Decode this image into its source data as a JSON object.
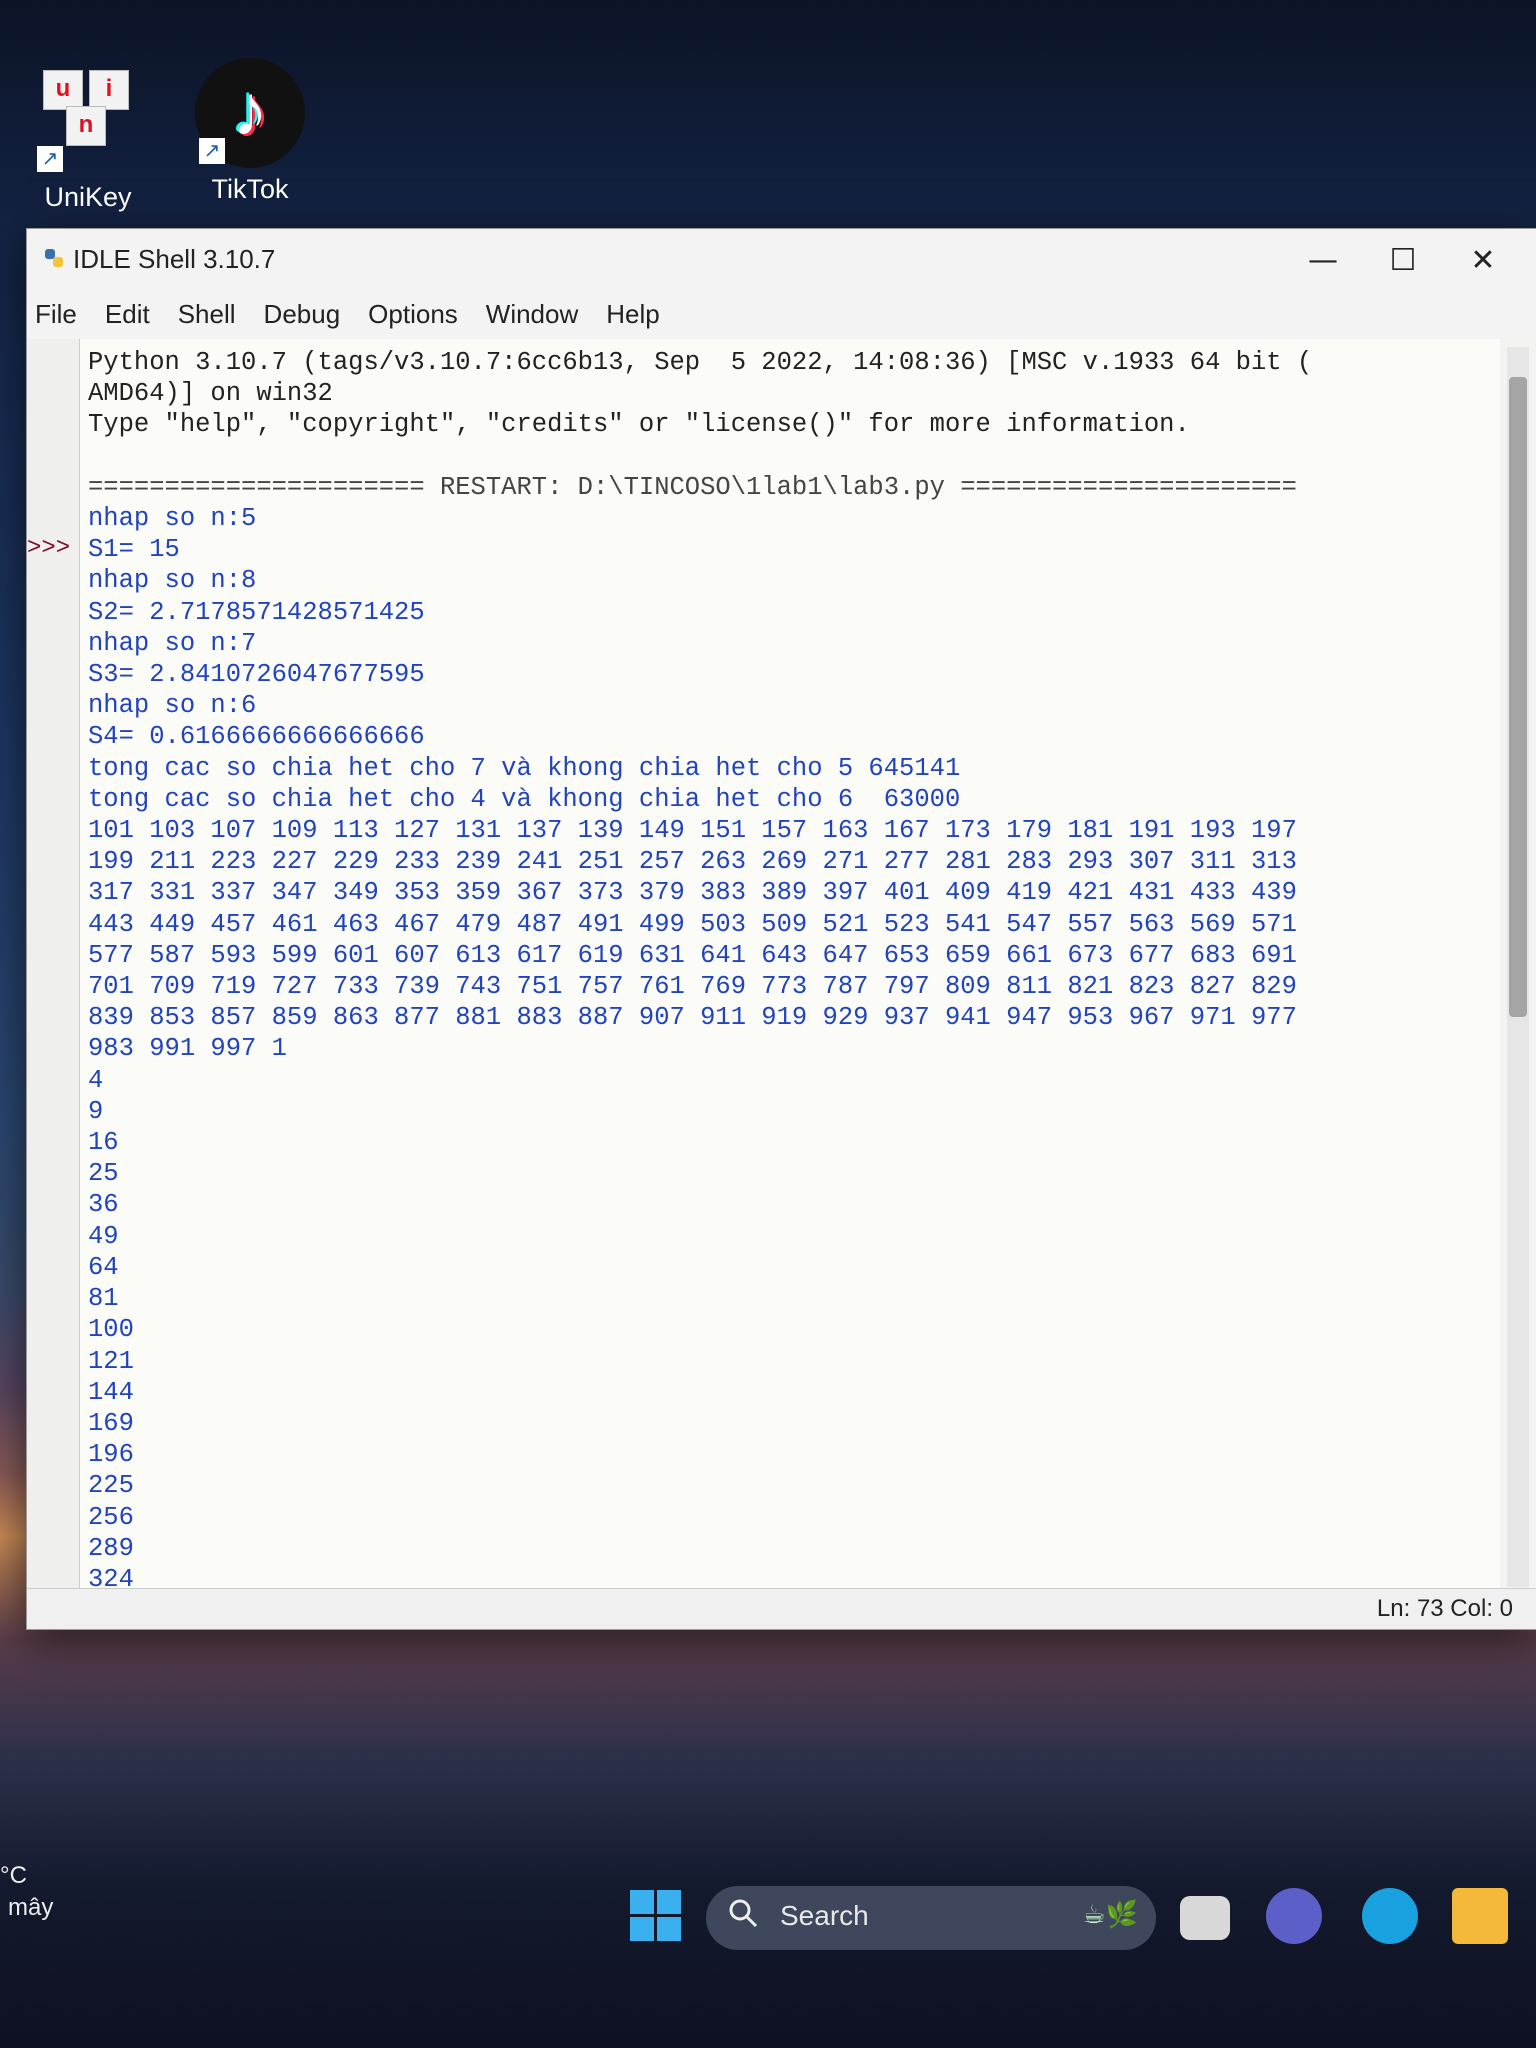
{
  "desktop": {
    "icons": [
      {
        "label": "UniKey",
        "letters": [
          "u",
          "i",
          "n"
        ]
      },
      {
        "label": "TikTok"
      }
    ]
  },
  "window": {
    "title": "IDLE Shell 3.10.7",
    "controls": {
      "minimize": "—",
      "maximize": "☐",
      "close": "✕"
    },
    "menu": [
      "File",
      "Edit",
      "Shell",
      "Debug",
      "Options",
      "Window",
      "Help"
    ],
    "prompt": ">>>",
    "shell_lines": [
      {
        "kind": "sys",
        "text": "Python 3.10.7 (tags/v3.10.7:6cc6b13, Sep  5 2022, 14:08:36) [MSC v.1933 64 bit ("
      },
      {
        "kind": "sys",
        "text": "AMD64)] on win32"
      },
      {
        "kind": "sys",
        "text": "Type \"help\", \"copyright\", \"credits\" or \"license()\" for more information."
      },
      {
        "kind": "sys",
        "text": ""
      },
      {
        "kind": "restart",
        "text": "====================== RESTART: D:\\TINCOSO\\1lab1\\lab3.py ======================"
      },
      {
        "kind": "out",
        "text": "nhap so n:5"
      },
      {
        "kind": "out",
        "text": "S1= 15"
      },
      {
        "kind": "out",
        "text": "nhap so n:8"
      },
      {
        "kind": "out",
        "text": "S2= 2.7178571428571425"
      },
      {
        "kind": "out",
        "text": "nhap so n:7"
      },
      {
        "kind": "out",
        "text": "S3= 2.8410726047677595"
      },
      {
        "kind": "out",
        "text": "nhap so n:6"
      },
      {
        "kind": "out",
        "text": "S4= 0.6166666666666666"
      },
      {
        "kind": "out",
        "text": "tong cac so chia het cho 7 và khong chia het cho 5 645141"
      },
      {
        "kind": "out",
        "text": "tong cac so chia het cho 4 và khong chia het cho 6  63000"
      },
      {
        "kind": "out",
        "text": "101 103 107 109 113 127 131 137 139 149 151 157 163 167 173 179 181 191 193 197"
      },
      {
        "kind": "out",
        "text": "199 211 223 227 229 233 239 241 251 257 263 269 271 277 281 283 293 307 311 313"
      },
      {
        "kind": "out",
        "text": "317 331 337 347 349 353 359 367 373 379 383 389 397 401 409 419 421 431 433 439"
      },
      {
        "kind": "out",
        "text": "443 449 457 461 463 467 479 487 491 499 503 509 521 523 541 547 557 563 569 571"
      },
      {
        "kind": "out",
        "text": "577 587 593 599 601 607 613 617 619 631 641 643 647 653 659 661 673 677 683 691"
      },
      {
        "kind": "out",
        "text": "701 709 719 727 733 739 743 751 757 761 769 773 787 797 809 811 821 823 827 829"
      },
      {
        "kind": "out",
        "text": "839 853 857 859 863 877 881 883 887 907 911 919 929 937 941 947 953 967 971 977"
      },
      {
        "kind": "out",
        "text": "983 991 997 1"
      },
      {
        "kind": "out",
        "text": "4"
      },
      {
        "kind": "out",
        "text": "9"
      },
      {
        "kind": "out",
        "text": "16"
      },
      {
        "kind": "out",
        "text": "25"
      },
      {
        "kind": "out",
        "text": "36"
      },
      {
        "kind": "out",
        "text": "49"
      },
      {
        "kind": "out",
        "text": "64"
      },
      {
        "kind": "out",
        "text": "81"
      },
      {
        "kind": "out",
        "text": "100"
      },
      {
        "kind": "out",
        "text": "121"
      },
      {
        "kind": "out",
        "text": "144"
      },
      {
        "kind": "out",
        "text": "169"
      },
      {
        "kind": "out",
        "text": "196"
      },
      {
        "kind": "out",
        "text": "225"
      },
      {
        "kind": "out",
        "text": "256"
      },
      {
        "kind": "out",
        "text": "289"
      },
      {
        "kind": "out",
        "text": "324"
      }
    ],
    "status": "Ln: 73  Col: 0"
  },
  "taskbar": {
    "weather_lines": [
      "°C",
      "mây"
    ],
    "search_label": "Search",
    "colors": {
      "start": "#3ab0ef",
      "teams": "#5b5fc7",
      "edge": "#1aa1e0",
      "explorer": "#f4b83a"
    }
  }
}
